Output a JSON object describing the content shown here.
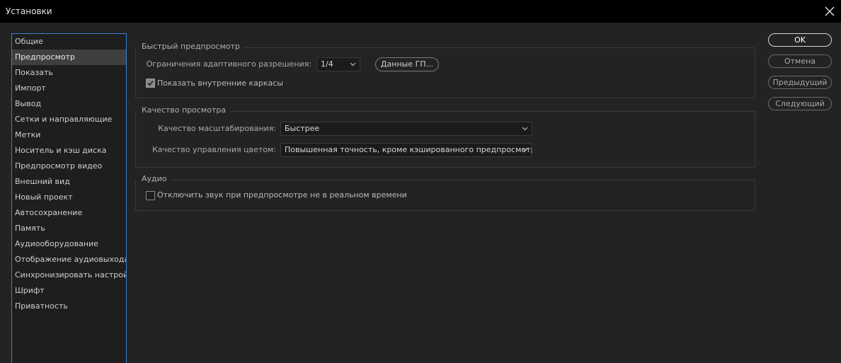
{
  "window": {
    "title": "Установки"
  },
  "sidebar": {
    "items": [
      {
        "label": "Общие"
      },
      {
        "label": "Предпросмотр"
      },
      {
        "label": "Показать"
      },
      {
        "label": "Импорт"
      },
      {
        "label": "Вывод"
      },
      {
        "label": "Сетки и направляющие"
      },
      {
        "label": "Метки"
      },
      {
        "label": "Носитель и кэш диска"
      },
      {
        "label": "Предпросмотр видео"
      },
      {
        "label": "Внешний вид"
      },
      {
        "label": "Новый проект"
      },
      {
        "label": "Автосохранение"
      },
      {
        "label": "Память"
      },
      {
        "label": "Аудиооборудование"
      },
      {
        "label": "Отображение аудиовыхода"
      },
      {
        "label": "Синхронизировать настройки"
      },
      {
        "label": "Шрифт"
      },
      {
        "label": "Приватность"
      }
    ],
    "selected_index": 1
  },
  "fast_preview": {
    "title": "Быстрый предпросмотр",
    "adaptive_label": "Ограничения адаптивного разрешения:",
    "adaptive_value": "1/4",
    "gpu_button": "Данные ГП...",
    "show_wireframes_label": "Показать внутренние каркасы",
    "show_wireframes_checked": true
  },
  "viewer_quality": {
    "title": "Качество просмотра",
    "zoom_label": "Качество масштабирования:",
    "zoom_value": "Быстрее",
    "color_label": "Качество управления цветом:",
    "color_value": "Повышенная точность, кроме кэшированного предпросмотра"
  },
  "audio": {
    "title": "Аудио",
    "mute_label": "Отключить звук при предпросмотре не в реальном времени",
    "mute_checked": false
  },
  "buttons": {
    "ok": "OK",
    "cancel": "Отмена",
    "previous": "Предыдущий",
    "next": "Следующий"
  }
}
